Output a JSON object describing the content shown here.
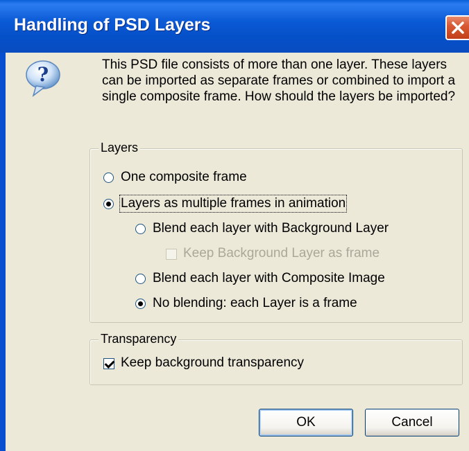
{
  "window": {
    "title": "Handling of PSD Layers",
    "title_bar_color": "#0a5fd8",
    "close_icon": "close-icon"
  },
  "dialog": {
    "icon": "question-icon",
    "message": "This PSD file consists of more than one layer. These layers can be imported as separate frames or combined to import a single composite frame. How should the layers be imported?"
  },
  "layers_group": {
    "legend": "Layers",
    "option_composite": "One composite frame",
    "option_multiple": "Layers as multiple frames in animation",
    "sub_blend_background": "Blend each layer with Background Layer",
    "sub_keep_background": "Keep Background Layer as frame",
    "sub_blend_composite": "Blend each layer with Composite Image",
    "sub_no_blending": "No blending: each Layer is a frame",
    "selected_main": "option_multiple",
    "selected_sub": "sub_no_blending"
  },
  "transparency_group": {
    "legend": "Transparency",
    "keep_transparency": "Keep background transparency",
    "keep_transparency_checked": true
  },
  "buttons": {
    "ok": "OK",
    "cancel": "Cancel"
  }
}
